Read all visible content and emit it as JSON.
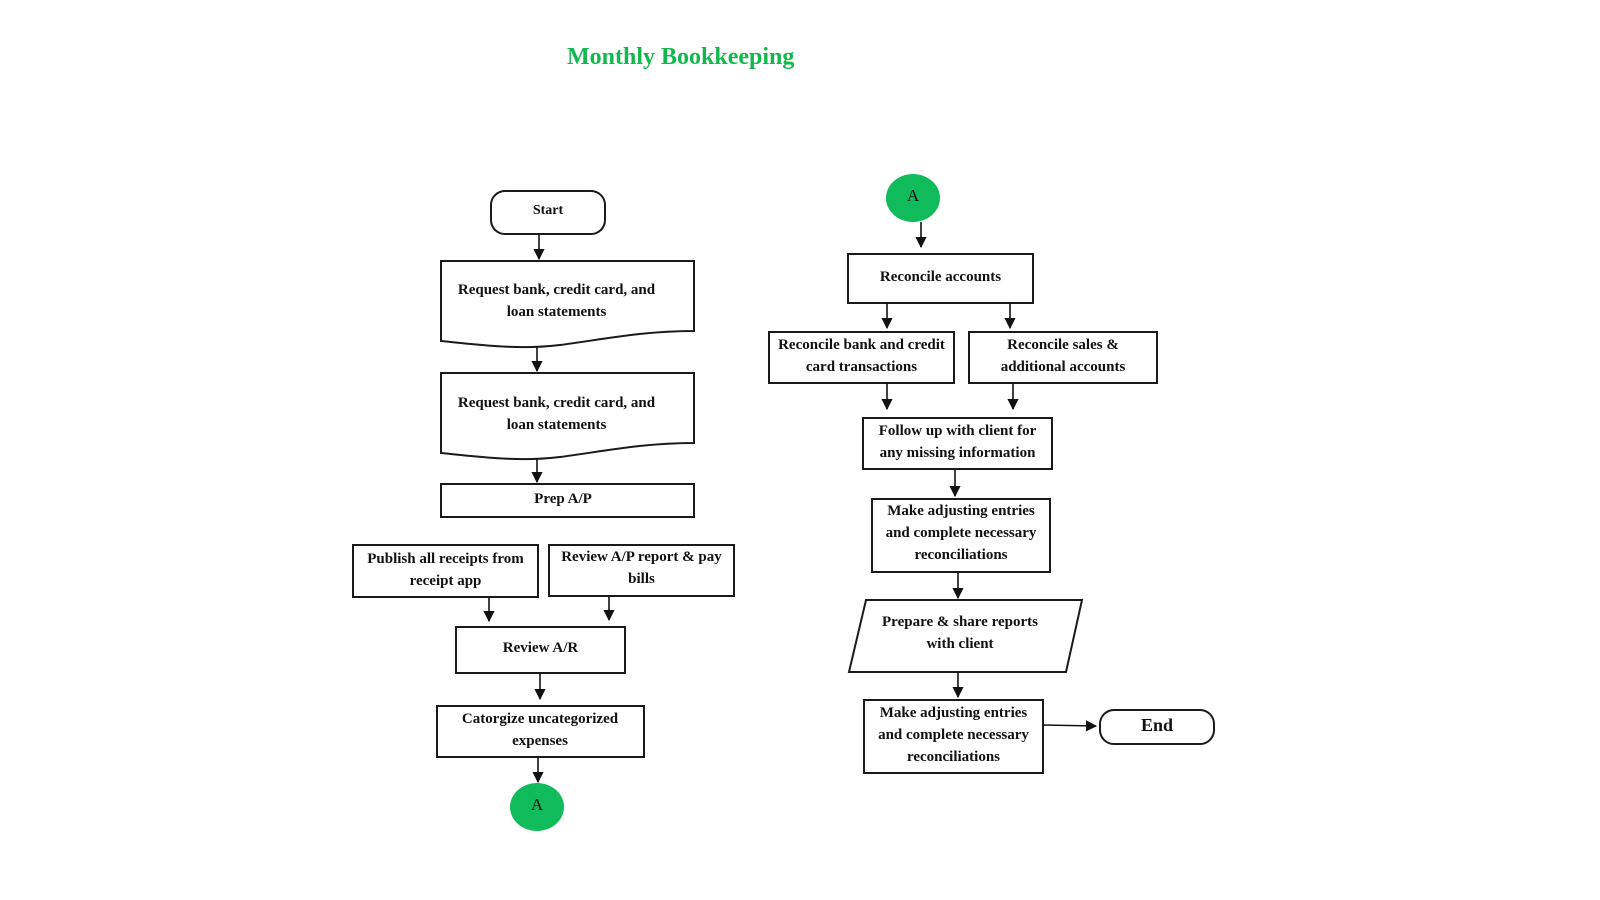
{
  "title": "Monthly Bookkeeping",
  "colors": {
    "title": "#12b84e",
    "connector": "#0fbb5a",
    "stroke": "#1a1a1a"
  },
  "nodes": {
    "start": {
      "label": "Start",
      "shape": "terminator"
    },
    "request1": {
      "label": "Request bank, credit card, and loan statements",
      "shape": "document"
    },
    "request2": {
      "label": "Request bank, credit card, and loan statements",
      "shape": "document"
    },
    "prep_ap": {
      "label": "Prep A/P",
      "shape": "process"
    },
    "publish_receipts": {
      "label": "Publish all receipts from receipt app",
      "shape": "process"
    },
    "review_ap": {
      "label": "Review A/P report & pay bills",
      "shape": "process"
    },
    "review_ar": {
      "label": "Review A/R",
      "shape": "process"
    },
    "categorize": {
      "label": "Catorgize uncategorized expenses",
      "shape": "process"
    },
    "connector_a_out": {
      "label": "A",
      "shape": "connector"
    },
    "connector_a_in": {
      "label": "A",
      "shape": "connector"
    },
    "reconcile_accounts": {
      "label": "Reconcile accounts",
      "shape": "process"
    },
    "reconcile_bank": {
      "label": "Reconcile bank and credit card transactions",
      "shape": "process"
    },
    "reconcile_sales": {
      "label": "Reconcile sales & additional accounts",
      "shape": "process"
    },
    "follow_up": {
      "label": "Follow up with client for any missing information",
      "shape": "process"
    },
    "adjusting1": {
      "label": "Make adjusting entries and complete necessary reconciliations",
      "shape": "process"
    },
    "prepare_reports": {
      "label": "Prepare & share reports with client",
      "shape": "data"
    },
    "adjusting2": {
      "label": "Make adjusting entries and complete necessary reconciliations",
      "shape": "process"
    },
    "end": {
      "label": "End",
      "shape": "terminator"
    }
  },
  "edges": [
    [
      "start",
      "request1"
    ],
    [
      "request1",
      "request2"
    ],
    [
      "request2",
      "prep_ap"
    ],
    [
      "publish_receipts",
      "review_ar"
    ],
    [
      "review_ap",
      "review_ar"
    ],
    [
      "review_ar",
      "categorize"
    ],
    [
      "categorize",
      "connector_a_out"
    ],
    [
      "connector_a_in",
      "reconcile_accounts"
    ],
    [
      "reconcile_accounts",
      "reconcile_bank"
    ],
    [
      "reconcile_accounts",
      "reconcile_sales"
    ],
    [
      "reconcile_bank",
      "follow_up"
    ],
    [
      "reconcile_sales",
      "follow_up"
    ],
    [
      "follow_up",
      "adjusting1"
    ],
    [
      "adjusting1",
      "prepare_reports"
    ],
    [
      "prepare_reports",
      "adjusting2"
    ],
    [
      "adjusting2",
      "end"
    ]
  ]
}
